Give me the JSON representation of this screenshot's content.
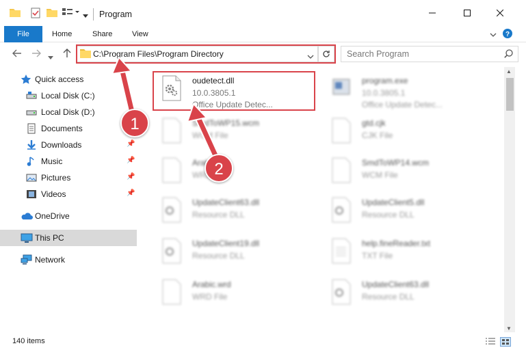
{
  "window": {
    "title": "Program"
  },
  "ribbon": {
    "tabs": [
      "File",
      "Home",
      "Share",
      "View"
    ]
  },
  "address": {
    "path": "C:\\Program Files\\Program Directory",
    "search_placeholder": "Search Program"
  },
  "sidebar": {
    "items": [
      {
        "label": "Quick access",
        "icon": "star-icon",
        "pinned": false
      },
      {
        "label": "Local Disk (C:)",
        "icon": "drive-icon",
        "pinned": false
      },
      {
        "label": "Local Disk (D:)",
        "icon": "drive-icon",
        "pinned": false
      },
      {
        "label": "Documents",
        "icon": "documents-icon",
        "pinned": false
      },
      {
        "label": "Downloads",
        "icon": "download-icon",
        "pinned": true
      },
      {
        "label": "Music",
        "icon": "music-icon",
        "pinned": true
      },
      {
        "label": "Pictures",
        "icon": "pictures-icon",
        "pinned": true
      },
      {
        "label": "Videos",
        "icon": "videos-icon",
        "pinned": true
      },
      {
        "label": "OneDrive",
        "icon": "cloud-icon",
        "pinned": false
      },
      {
        "label": "This PC",
        "icon": "pc-icon",
        "pinned": false,
        "selected": true
      },
      {
        "label": "Network",
        "icon": "network-icon",
        "pinned": false
      }
    ]
  },
  "files": [
    {
      "name": "oudetect.dll",
      "line2": "10.0.3805.1",
      "line3": "Office Update Detec...",
      "highlighted": true
    },
    {
      "name": "program.exe",
      "line2": "10.0.3805.1",
      "line3": "Office Update Detec..."
    },
    {
      "name": "SmdToWP15.wcm",
      "line2": "WCM File",
      "line3": ""
    },
    {
      "name": "gtd.cjk",
      "line2": "CJK File",
      "line3": ""
    },
    {
      "name": "Arabic.lex",
      "line2": "WRD File",
      "line3": ""
    },
    {
      "name": "SmdToWP14.wcm",
      "line2": "WCM File",
      "line3": ""
    },
    {
      "name": "UpdateClient63.dll",
      "line2": "Resource DLL",
      "line3": ""
    },
    {
      "name": "UpdateClient5.dll",
      "line2": "Resource DLL",
      "line3": ""
    },
    {
      "name": "UpdateClient19.dll",
      "line2": "Resource DLL",
      "line3": ""
    },
    {
      "name": "help.fineReader.txt",
      "line2": "TXT File",
      "line3": ""
    },
    {
      "name": "Arabic.wrd",
      "line2": "WRD File",
      "line3": ""
    },
    {
      "name": "UpdateClient63.dll",
      "line2": "Resource DLL",
      "line3": ""
    }
  ],
  "status": {
    "item_count": "140 items"
  },
  "annotations": {
    "marker1": "1",
    "marker2": "2"
  },
  "colors": {
    "accent": "#1979ca",
    "highlight": "#d9434a"
  }
}
